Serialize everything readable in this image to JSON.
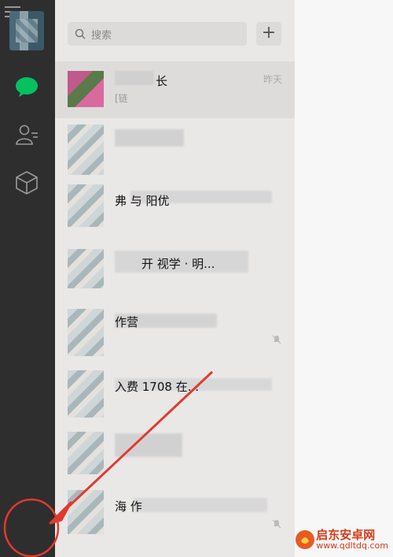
{
  "sidebar": {
    "icons": [
      "chat-icon",
      "contacts-icon",
      "box-icon",
      "menu-icon"
    ],
    "active_color": "#07c160"
  },
  "search": {
    "placeholder": "搜索",
    "add_label": "+"
  },
  "chats": [
    {
      "name": "长",
      "sub": "[链",
      "time": "昨天",
      "muted": false
    },
    {
      "name": "",
      "sub": "",
      "time": "",
      "muted": false
    },
    {
      "name": "弗          与        阳优",
      "sub": "",
      "time": "",
      "muted": false
    },
    {
      "name": "开     视学  ·    明...",
      "sub": "",
      "time": "",
      "muted": false
    },
    {
      "name": "            作营",
      "sub": "",
      "time": "",
      "muted": true
    },
    {
      "name": "       入费    1708     在...",
      "sub": "",
      "time": "",
      "muted": false
    },
    {
      "name": "",
      "sub": "",
      "time": "",
      "muted": false
    },
    {
      "name": "海        作",
      "sub": "",
      "time": "",
      "muted": true
    }
  ],
  "watermark": {
    "cn": "启东安卓网",
    "url": "www.qdltdq.com"
  },
  "annotation_color": "#e03a2e"
}
